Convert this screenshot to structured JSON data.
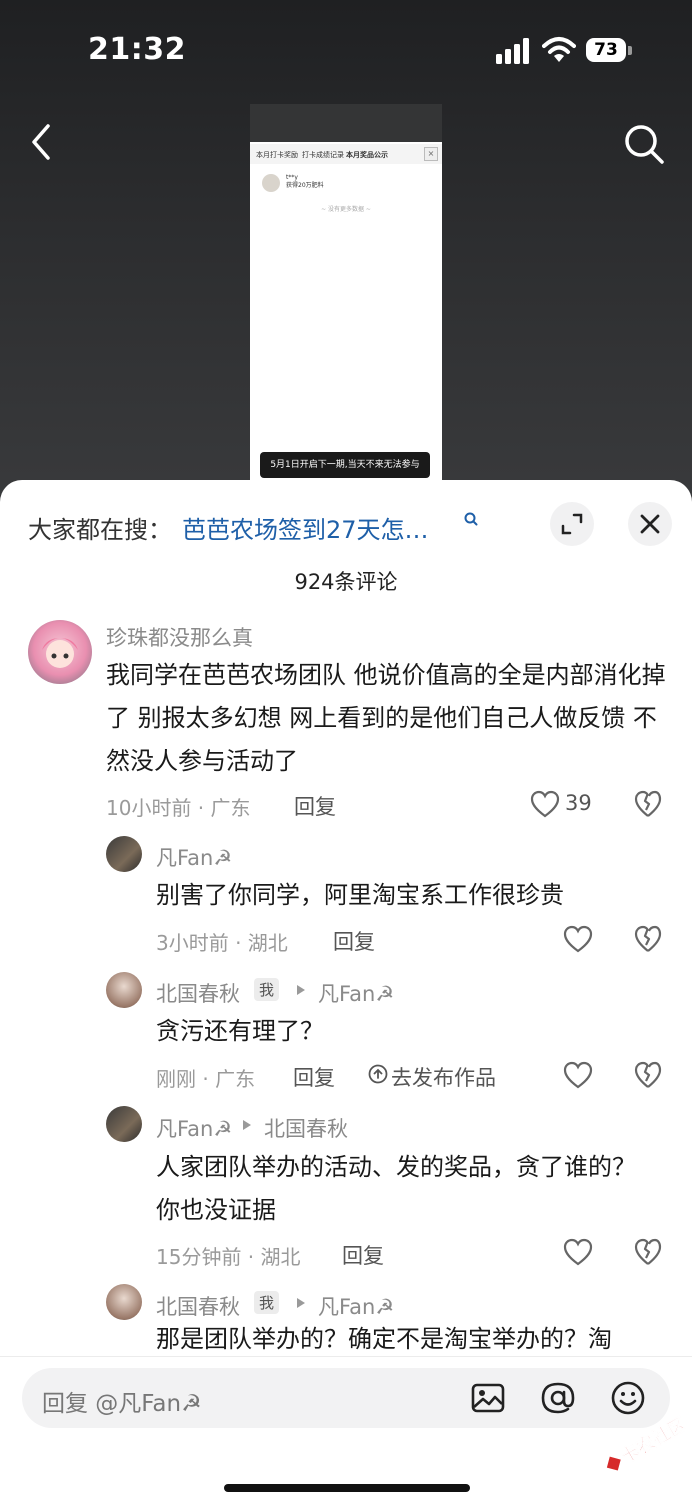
{
  "status_bar": {
    "time": "21:32",
    "battery": "73"
  },
  "preview": {
    "tabs": [
      "本月打卡奖励",
      "打卡成绩记录",
      "本月奖品公示"
    ],
    "winner_name": "t**y",
    "winner_prize": "获得20万肥料",
    "more": "~ 没有更多数据 ~",
    "bottom_bar": "5月1日开启下一期,当天不来无法参与"
  },
  "sheet": {
    "search_label": "大家都在搜：",
    "search_query": "芭芭农场签到27天怎…",
    "comment_count": "924条评论"
  },
  "comments": [
    {
      "user": "珍珠都没那么真",
      "text": "我同学在芭芭农场团队 他说价值高的全是内部消化掉了 别报太多幻想 网上看到的是他们自己人做反馈  不然没人参与活动了",
      "meta": "10小时前 · 广东",
      "reply": "回复",
      "likes": "39"
    },
    {
      "user": "凡Fan☭",
      "text": "别害了你同学，阿里淘宝系工作很珍贵",
      "meta": "3小时前 · 湖北",
      "reply": "回复"
    },
    {
      "user": "北国春秋",
      "badge": "我",
      "reply_to": "凡Fan☭",
      "text": "贪污还有理了？",
      "meta": "刚刚 · 广东",
      "reply": "回复",
      "publish": "去发布作品"
    },
    {
      "user": "凡Fan☭",
      "reply_to": "北国春秋",
      "text": "人家团队举办的活动、发的奖品，贪了谁的？你也没证据",
      "meta": "15分钟前 · 湖北",
      "reply": "回复"
    },
    {
      "user": "北国春秋",
      "badge": "我",
      "reply_to": "凡Fan☭",
      "text": "那是团队举办的？确定不是淘宝举办的？淘"
    }
  ],
  "input": {
    "placeholder": "回复 @凡Fan☭"
  },
  "watermark": "卡农社区",
  "icons": [
    "back-arrow-icon",
    "search-icon",
    "expand-icon",
    "close-icon",
    "heart-icon",
    "broken-heart-icon",
    "image-icon",
    "at-icon",
    "emoji-icon",
    "upload-icon"
  ],
  "colors": {
    "link": "#1e5fa8",
    "watermark": "#d62a2a"
  }
}
